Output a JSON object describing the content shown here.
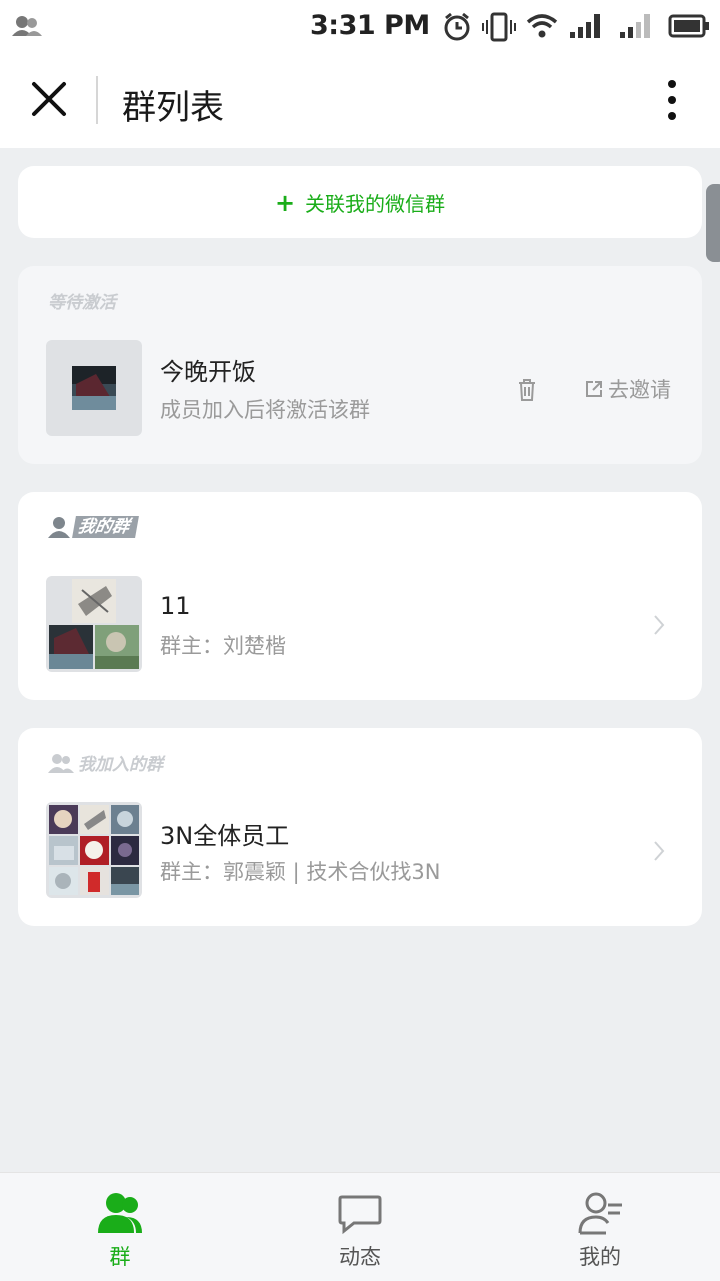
{
  "status_bar": {
    "time": "3:31 PM"
  },
  "header": {
    "title": "群列表"
  },
  "link_group_button": {
    "label": "关联我的微信群"
  },
  "pending_section": {
    "label": "等待激活",
    "group": {
      "name": "今晚开饭",
      "subtitle": "成员加入后将激活该群",
      "invite_label": "去邀请"
    }
  },
  "my_groups_section": {
    "label": "我的群",
    "group": {
      "name": "11",
      "owner": "群主：刘楚楷"
    }
  },
  "joined_section": {
    "label": "我加入的群",
    "group": {
      "name": "3N全体员工",
      "owner": "群主：郭震颖 | 技术合伙找3N"
    }
  },
  "tabs": [
    {
      "label": "群",
      "active": true
    },
    {
      "label": "动态",
      "active": false
    },
    {
      "label": "我的",
      "active": false
    }
  ],
  "colors": {
    "accent": "#1aad19",
    "background": "#edeff1"
  }
}
